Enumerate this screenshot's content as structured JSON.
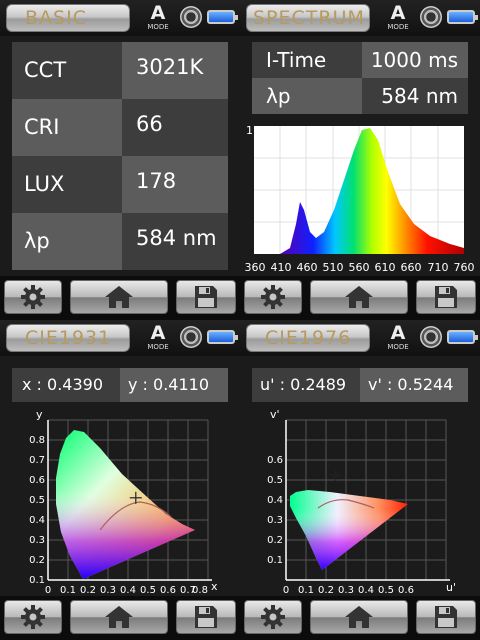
{
  "basic": {
    "tab_label": "BASIC",
    "mode_letter": "A",
    "mode_label": "MODE",
    "rows": [
      {
        "label": "CCT",
        "value": "3021K"
      },
      {
        "label": "CRI",
        "value": "66"
      },
      {
        "label": "LUX",
        "value": "178"
      },
      {
        "label": "λp",
        "value": "584 nm"
      }
    ]
  },
  "spectrum": {
    "tab_label": "SPECTRUM",
    "mode_letter": "A",
    "mode_label": "MODE",
    "itime_label": "I-Time",
    "itime_value": "1000 ms",
    "peak_label": "λp",
    "peak_value": "584 nm",
    "y_label": "1",
    "x_ticks": [
      "360",
      "410",
      "460",
      "510",
      "560",
      "610",
      "660",
      "710",
      "760"
    ]
  },
  "cie1931": {
    "tab_label": "CIE1931",
    "mode_letter": "A",
    "mode_label": "MODE",
    "x_text": "x : 0.4390",
    "y_text": "y : 0.4110",
    "axis_y_label": "y",
    "axis_x_label": "x",
    "y_ticks": [
      "0.8",
      "0.7",
      "0.6",
      "0.5",
      "0.4",
      "0.3",
      "0.2",
      "0.1"
    ],
    "x_ticks": [
      "0",
      "0.1",
      "0.2",
      "0.3",
      "0.4",
      "0.5",
      "0.6",
      "0.7",
      "0.8"
    ],
    "point": {
      "x": 0.439,
      "y": 0.411
    }
  },
  "cie1976": {
    "tab_label": "CIE1976",
    "mode_letter": "A",
    "mode_label": "MODE",
    "u_text": "u' : 0.2489",
    "v_text": "v' : 0.5244",
    "axis_y_label": "v'",
    "axis_x_label": "u'",
    "y_ticks": [
      "0.6",
      "0.5",
      "0.4",
      "0.3",
      "0.2",
      "0.1"
    ],
    "x_ticks": [
      "0",
      "0.1",
      "0.2",
      "0.3",
      "0.4",
      "0.5",
      "0.6"
    ],
    "point": {
      "u": 0.2489,
      "v": 0.5244
    }
  },
  "colors": {
    "tab_text": "#b79a5d",
    "cell_dark": "#3d3d3d",
    "cell_light": "#5c5c5c"
  },
  "icons": [
    "gear-icon",
    "home-icon",
    "save-icon",
    "battery-icon",
    "dial-icon"
  ]
}
